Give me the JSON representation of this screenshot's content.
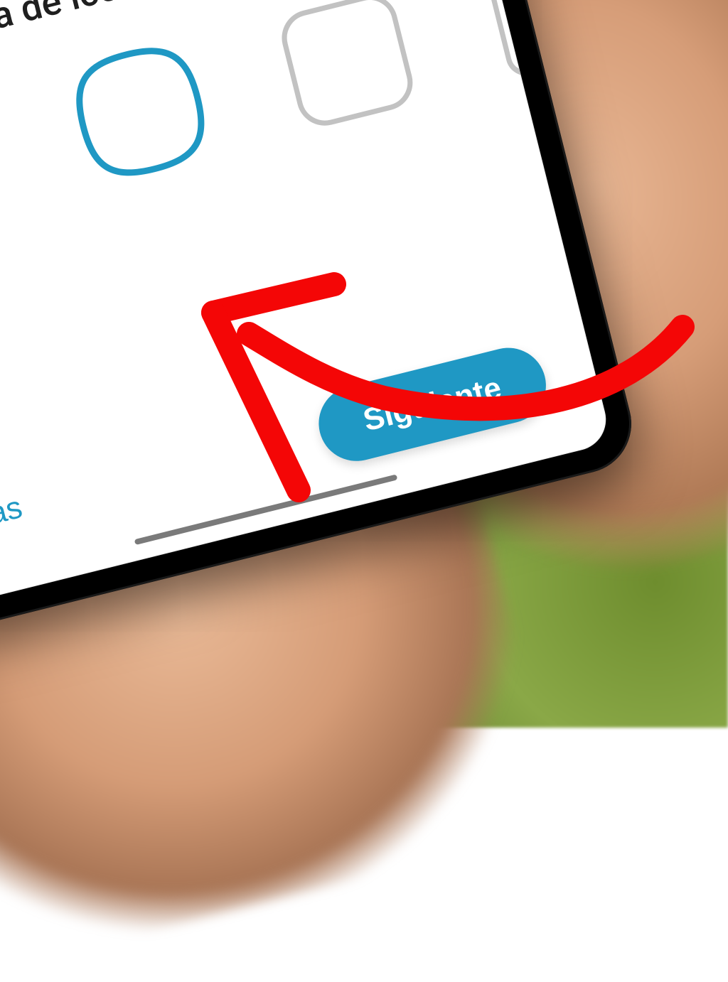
{
  "title_partial": "e una forma de icono",
  "shapes": {
    "teardrop": {
      "selected": false,
      "stroke": "#c2c2c2"
    },
    "squircle": {
      "selected": true,
      "stroke": "#1f98c4"
    },
    "rounded_square": {
      "selected": false,
      "stroke": "#c2c2c2"
    },
    "edge_cut": {
      "selected": false,
      "stroke": "#c2c2c2"
    }
  },
  "buttons": {
    "back_label_partial": "trás",
    "next_label": "Siguiente"
  },
  "colors": {
    "accent": "#1f98c4",
    "annotation": "#f40606"
  }
}
